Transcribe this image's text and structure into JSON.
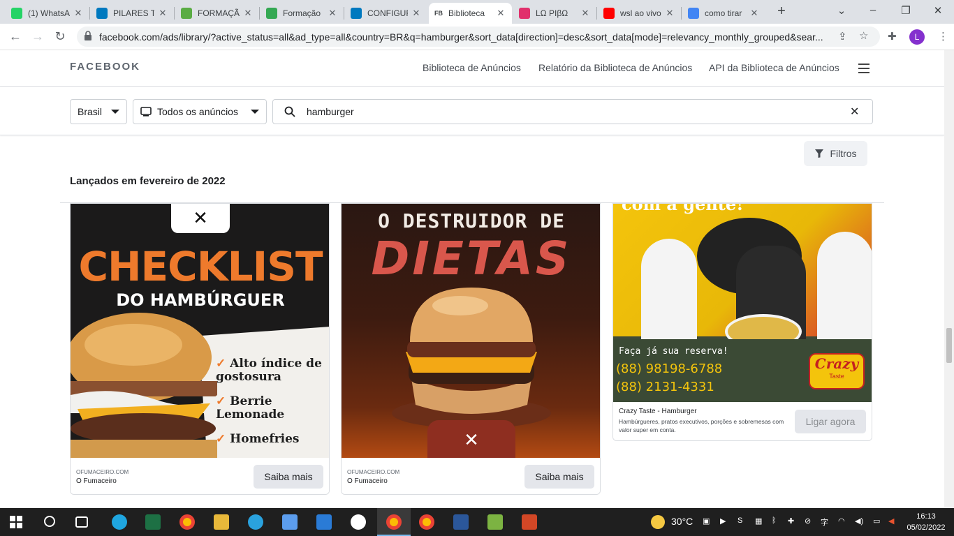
{
  "tabs": [
    {
      "label": "(1) WhatsA",
      "icon": "whatsapp-icon",
      "color": "#25d366"
    },
    {
      "label": "PILARES TE",
      "icon": "trello-icon",
      "color": "#0079bf"
    },
    {
      "label": "FORMAÇÃ",
      "icon": "trello-icon",
      "color": "#5aac44"
    },
    {
      "label": "Formação",
      "icon": "chat-icon",
      "color": "#34a853"
    },
    {
      "label": "CONFIGUR",
      "icon": "trello-icon",
      "color": "#0079bf"
    },
    {
      "label": "Biblioteca",
      "icon": "fb-icon",
      "color": "#1877f2",
      "prefix": "FB"
    },
    {
      "label": "LΩ PIβΩ",
      "icon": "instagram-icon",
      "color": "#e1306c"
    },
    {
      "label": "wsl ao vivo",
      "icon": "youtube-icon",
      "color": "#ff0000"
    },
    {
      "label": "como tirar",
      "icon": "google-icon",
      "color": "#4285f4"
    }
  ],
  "browser": {
    "url": "facebook.com/ads/library/?active_status=all&ad_type=all&country=BR&q=hamburger&sort_data[direction]=desc&sort_data[mode]=relevancy_monthly_grouped&sear...",
    "avatar": "L"
  },
  "header": {
    "logo": "FACEBOOK",
    "nav": [
      "Biblioteca de Anúncios",
      "Relatório da Biblioteca de Anúncios",
      "API da Biblioteca de Anúncios"
    ]
  },
  "search": {
    "country": "Brasil",
    "ad_type": "Todos os anúncios",
    "query": "hamburger"
  },
  "filters_label": "Filtros",
  "section_title": "Lançados em fevereiro de 2022",
  "cards": [
    {
      "headline": "CHECKLIST",
      "subhead": "DO HAMBÚRGUER",
      "bullets": [
        "Alto índice de gostosura",
        "Berrie Lemonade",
        "Homefries"
      ],
      "domain": "OFUMACEIRO.COM",
      "advertiser": "O Fumaceiro",
      "cta": "Saiba mais"
    },
    {
      "headline": "O DESTRUIDOR DE",
      "subhead": "DIETAS",
      "domain": "OFUMACEIRO.COM",
      "advertiser": "O Fumaceiro",
      "cta": "Saiba mais"
    },
    {
      "top_text": "com a gente!",
      "reserve": "Faça já sua reserva!",
      "phones": [
        "(88) 98198-6788",
        "(88) 2131-4331"
      ],
      "brand": "Crazy",
      "brand_sub": "Taste",
      "title": "Crazy Taste - Hamburger",
      "desc": "Hambúrgueres, pratos executivos, porções e sobremesas com valor super em conta.",
      "cta": "Ligar agora"
    }
  ],
  "taskbar": {
    "weather": "30°C",
    "time": "16:13",
    "date": "05/02/2022"
  }
}
